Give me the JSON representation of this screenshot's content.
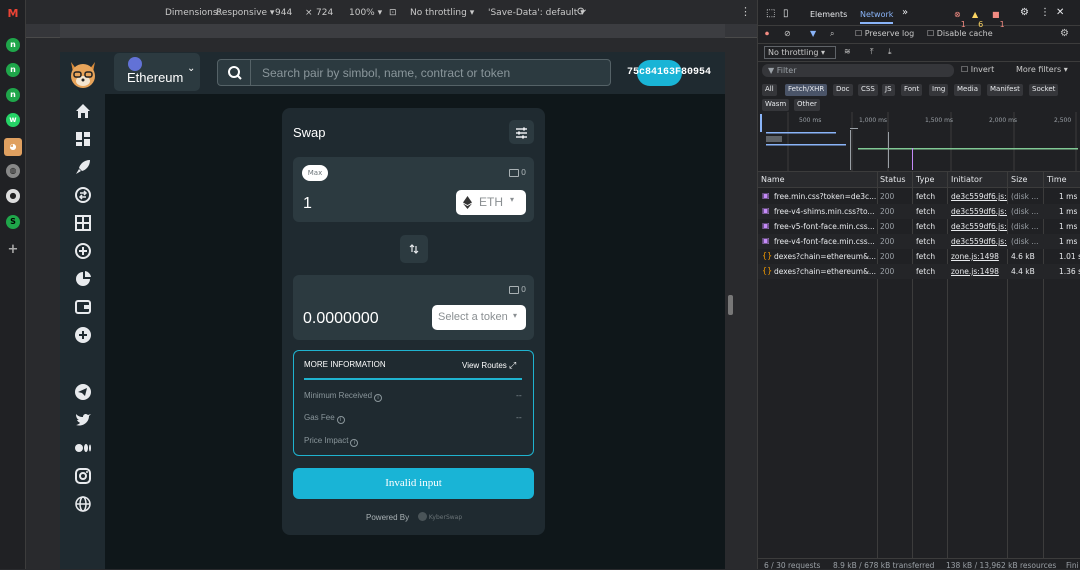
{
  "browser": {
    "left_icons": [
      "gmail-icon",
      "app-icon",
      "app-icon",
      "app-icon",
      "whatsapp-icon",
      "shiba-icon",
      "globe-icon",
      "github-icon",
      "app-icon",
      "plus-icon"
    ]
  },
  "responsive_bar": {
    "dimensions_label": "Dimensions:",
    "dimensions_mode": "Responsive",
    "width": "944",
    "times": "×",
    "height": "724",
    "zoom": "100%",
    "throttling": "No throttling",
    "save_data": "'Save-Data': default"
  },
  "app": {
    "chain_name": "Ethereum",
    "search_placeholder": "Search pair by simbol, name, contract or token",
    "address": "75c84163F80954"
  },
  "swap": {
    "title": "Swap",
    "max_label": "Max",
    "from_balance": "0",
    "from_amount": "1",
    "from_token": "ETH",
    "to_balance": "0",
    "to_amount": "0.0000000",
    "select_token_label": "Select a token",
    "more_info_title": "MORE INFORMATION",
    "view_routes_label": "View Routes",
    "min_received_label": "Minimum Received",
    "min_received_value": "--",
    "gas_fee_label": "Gas Fee",
    "gas_fee_value": "--",
    "price_impact_label": "Price Impact",
    "action_label": "Invalid input",
    "powered_by": "Powered By",
    "powered_brand": "KyberSwap"
  },
  "devtools": {
    "tab_elements": "Elements",
    "tab_network": "Network",
    "errors": "1",
    "warnings": "6",
    "issues": "1",
    "preserve_log": "Preserve log",
    "disable_cache": "Disable cache",
    "throttling": "No throttling",
    "filter_placeholder": "Filter",
    "invert": "Invert",
    "more_filters": "More filters",
    "filter_types": [
      "All",
      "Fetch/XHR",
      "Doc",
      "CSS",
      "JS",
      "Font",
      "Img",
      "Media",
      "Manifest",
      "Socket",
      "Wasm",
      "Other"
    ],
    "timeline_ticks": [
      "500 ms",
      "1,000 ms",
      "1,500 ms",
      "2,000 ms",
      "2,500"
    ],
    "columns": [
      "Name",
      "Status",
      "Type",
      "Initiator",
      "Size",
      "Time"
    ],
    "rows": [
      {
        "name": "free.min.css?token=de3c...",
        "status": "200",
        "type": "fetch",
        "initiator": "de3c559df6.js:2",
        "size": "(disk ...",
        "time": "1 ms"
      },
      {
        "name": "free-v4-shims.min.css?to...",
        "status": "200",
        "type": "fetch",
        "initiator": "de3c559df6.js:2",
        "size": "(disk ...",
        "time": "1 ms"
      },
      {
        "name": "free-v5-font-face.min.css...",
        "status": "200",
        "type": "fetch",
        "initiator": "de3c559df6.js:2",
        "size": "(disk ...",
        "time": "1 ms"
      },
      {
        "name": "free-v4-font-face.min.css...",
        "status": "200",
        "type": "fetch",
        "initiator": "de3c559df6.js:2",
        "size": "(disk ...",
        "time": "1 ms"
      },
      {
        "name": "dexes?chain=ethereum&...",
        "status": "200",
        "type": "fetch",
        "initiator": "zone.js:1498",
        "size": "4.6 kB",
        "time": "1.01 s"
      },
      {
        "name": "dexes?chain=ethereum&...",
        "status": "200",
        "type": "fetch",
        "initiator": "zone.js:1498",
        "size": "4.4 kB",
        "time": "1.36 s"
      }
    ],
    "status_requests": "6 / 30 requests",
    "status_transferred": "8.9 kB / 678 kB transferred",
    "status_resources": "138 kB / 13,962 kB resources",
    "status_finish": "Fini"
  },
  "colors": {
    "accent": "#19b4d6",
    "card": "#1f2a30",
    "input": "#2c3a40",
    "page": "#0f171a"
  }
}
